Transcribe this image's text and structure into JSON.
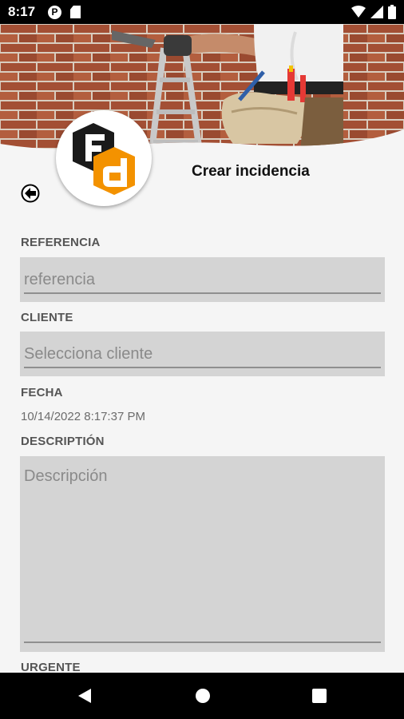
{
  "status_bar": {
    "time": "8:17",
    "notification_icon": "p-badge-icon",
    "icons": [
      "sd-card-icon",
      "wifi-icon",
      "signal-icon",
      "battery-icon"
    ]
  },
  "header": {
    "banner": "handyman-banner-photo",
    "logo": "fd-logo"
  },
  "page": {
    "title": "Crear incidencia",
    "back_icon": "back-arrow-icon"
  },
  "form": {
    "referencia": {
      "label": "REFERENCIA",
      "placeholder": "referencia",
      "value": ""
    },
    "cliente": {
      "label": "CLIENTE",
      "placeholder": "Selecciona cliente",
      "value": ""
    },
    "fecha": {
      "label": "FECHA",
      "value": "10/14/2022 8:17:37 PM"
    },
    "descripcion": {
      "label": "DESCRIPTIÓN",
      "placeholder": "Descripción",
      "value": ""
    },
    "urgente": {
      "label": "URGENTE"
    }
  },
  "nav_bar": {
    "back": "nav-back-icon",
    "home": "nav-home-icon",
    "recents": "nav-recents-icon"
  },
  "colors": {
    "accent_orange": "#f39200",
    "logo_black": "#1a1a1a",
    "input_background": "#d4d4d4",
    "page_background": "#f5f5f5"
  }
}
